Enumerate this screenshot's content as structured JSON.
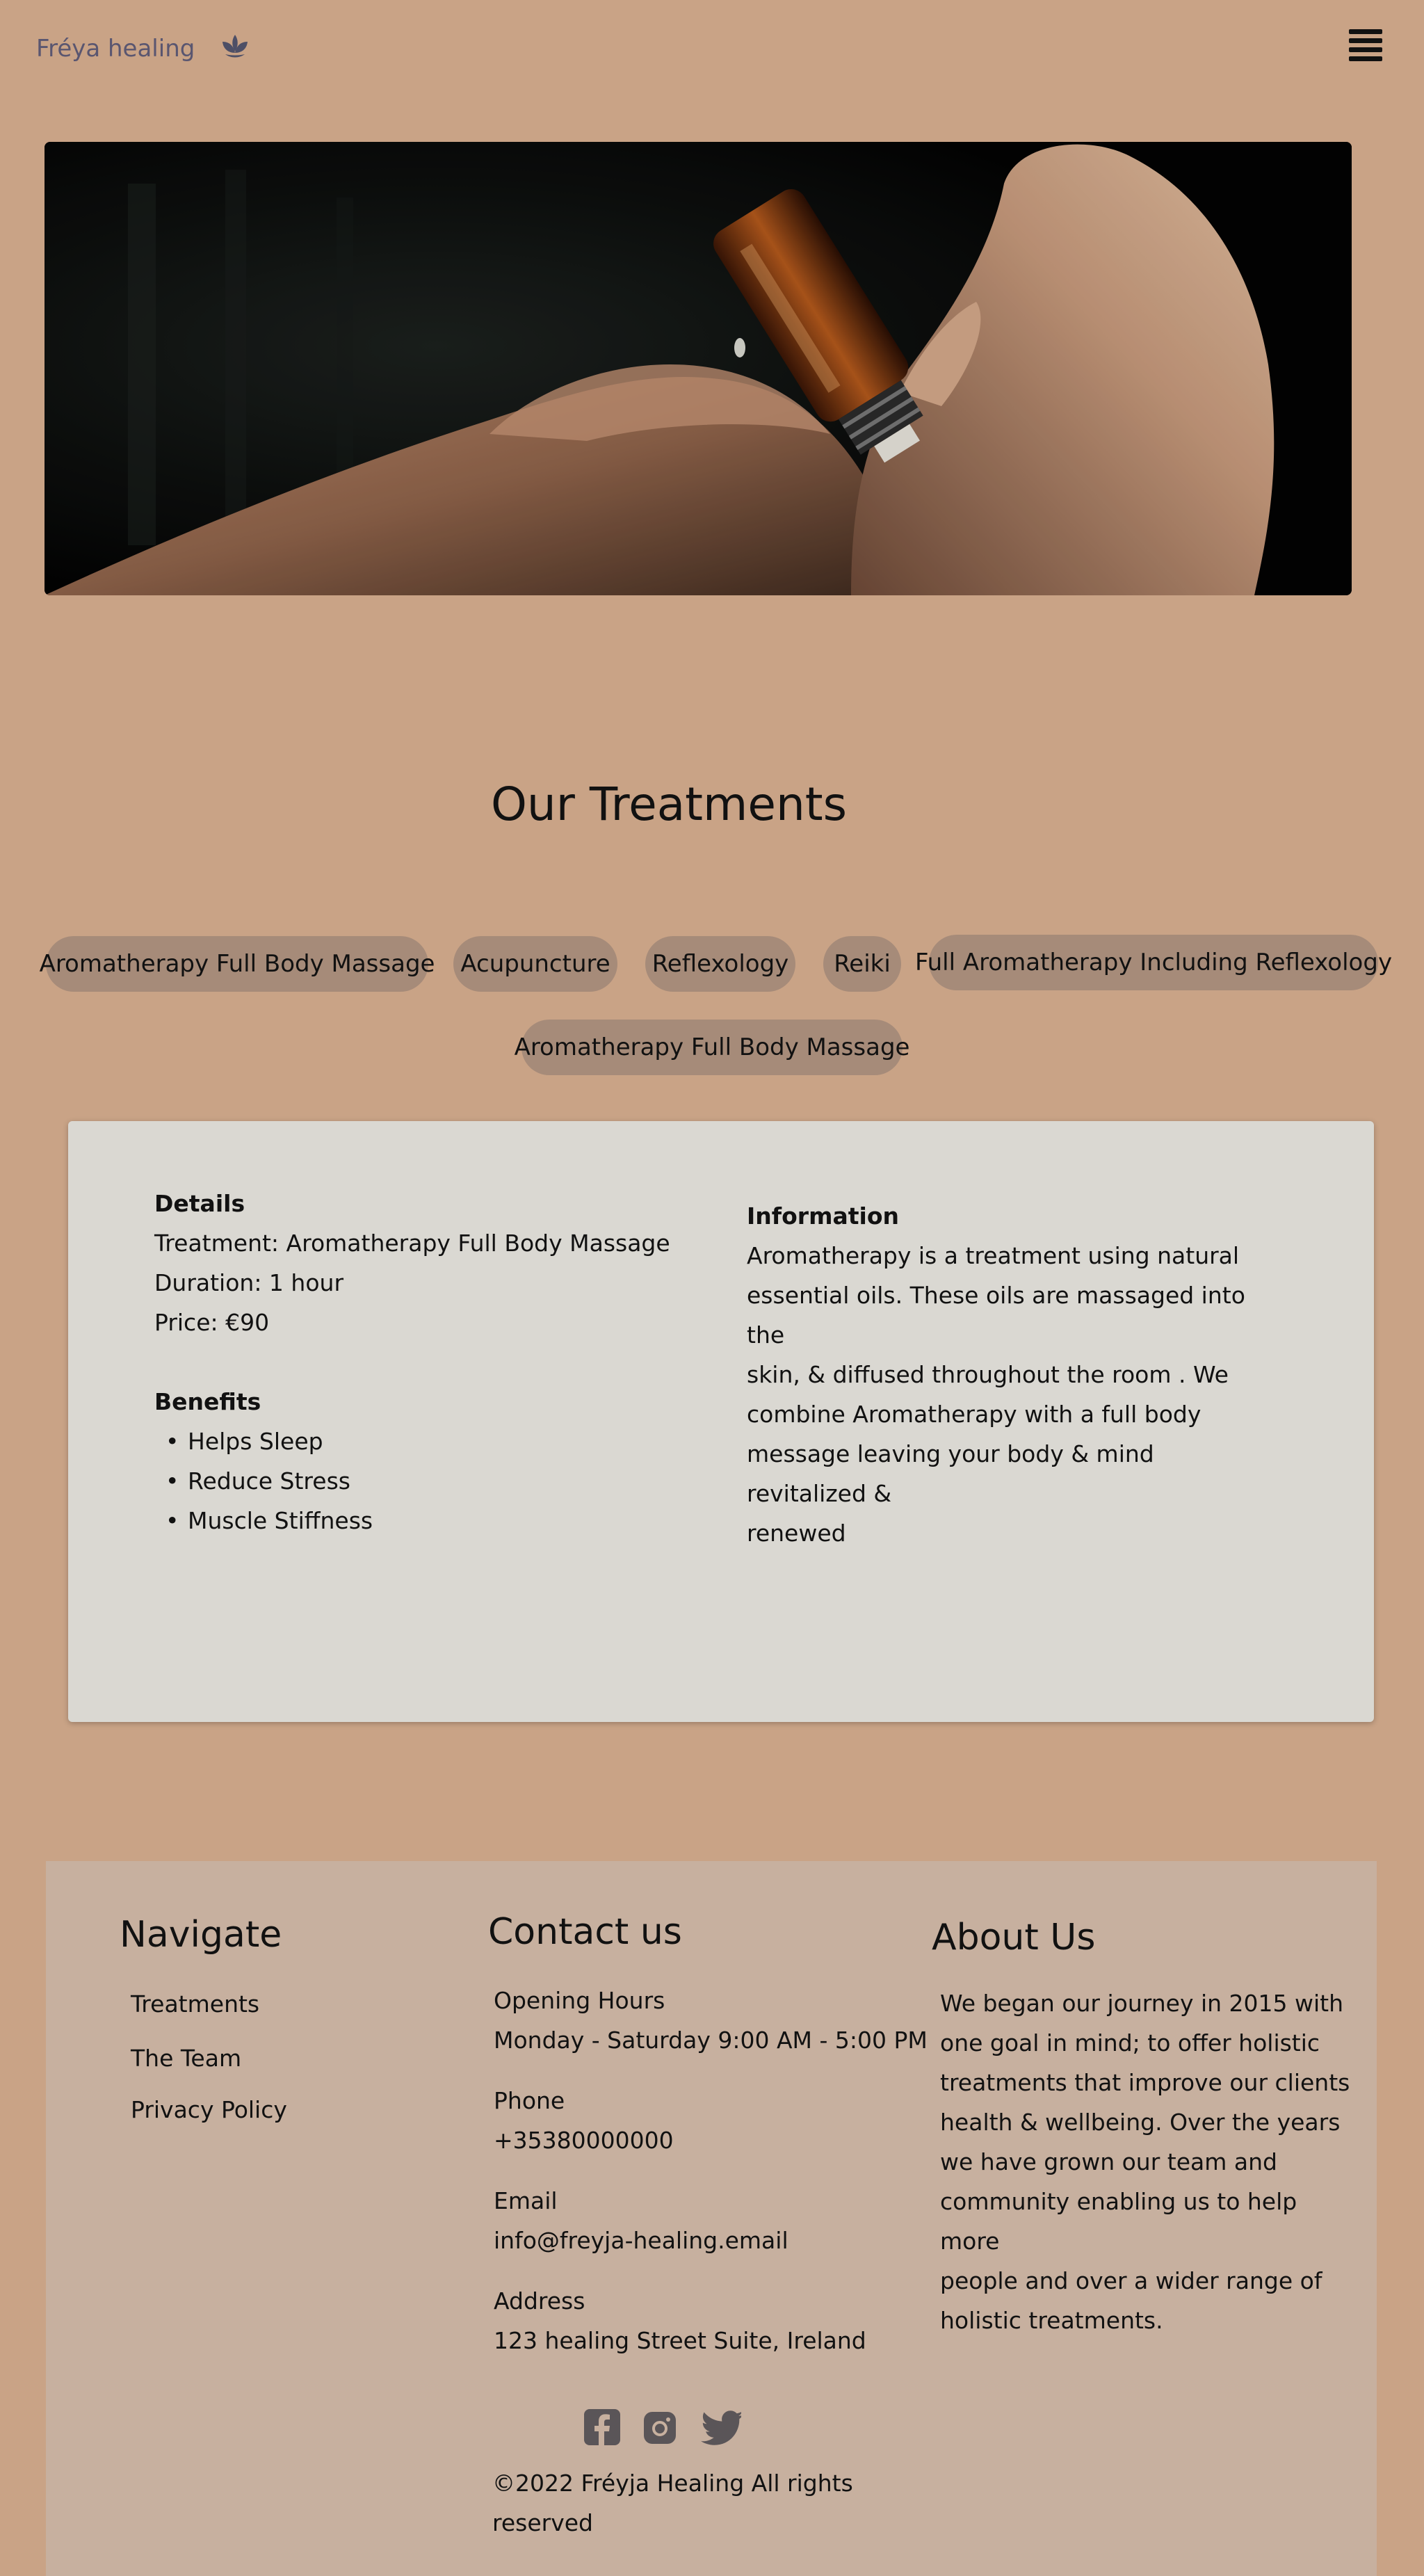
{
  "header": {
    "brand": "Fréya healing",
    "logo_icon": "lotus-icon",
    "menu_icon": "hamburger-menu-icon"
  },
  "hero": {
    "image_icon": "aromatherapy-oil-bottle-photo"
  },
  "treatments": {
    "title": "Our Treatments",
    "tabs": [
      "Aromatherapy Full Body Massage",
      "Acupuncture",
      "Reflexology",
      "Reiki",
      "Full Aromatherapy Including Reflexology",
      "Aromatherapy Full Body Massage"
    ]
  },
  "details": {
    "details_heading": "Details",
    "treatment": "Treatment: Aromatherapy Full Body Massage",
    "duration": "Duration: 1 hour",
    "price": "Price: €90",
    "benefits_heading": "Benefits",
    "benefits": [
      "Helps Sleep",
      "Reduce Stress",
      "Muscle Stiffness"
    ],
    "information_heading": "Information",
    "information_lines": [
      "Aromatherapy is a treatment using natural",
      "essential oils. These oils are massaged into the",
      "skin, & diffused throughout the room . We",
      "combine Aromatherapy with a full body",
      "message leaving your body & mind revitalized &",
      "renewed"
    ]
  },
  "footer": {
    "navigate_heading": "Navigate",
    "nav_links": [
      "Treatments",
      "The Team",
      "Privacy Policy"
    ],
    "contact_heading": "Contact us",
    "opening_hours_label": "Opening Hours",
    "opening_hours_value": "Monday - Saturday 9:00 AM - 5:00 PM",
    "phone_label": "Phone",
    "phone_value": "+35380000000",
    "email_label": "Email",
    "email_value": "info@freyja-healing.email",
    "address_label": "Address",
    "address_value": "123 healing Street Suite, Ireland",
    "social_icons": [
      "facebook-icon",
      "instagram-icon",
      "twitter-icon"
    ],
    "copyright_lines": [
      "©2022 Fréyja Healing All rights",
      "reserved"
    ],
    "about_heading": "About Us",
    "about_lines": [
      "We began our journey in 2015 with",
      "one goal in mind; to offer holistic",
      "treatments that improve our clients",
      "health & wellbeing. Over the years",
      "we have grown our team and",
      "community enabling us to help more",
      "people and over a wider range of",
      "holistic treatments."
    ]
  },
  "colors": {
    "page_background": "#c9a386",
    "pill_background": "#a68b79",
    "card_background": "#dad8d2",
    "footer_background": "#c7b09f",
    "brand_text": "#5a5670",
    "social_icon": "#5a5558"
  }
}
